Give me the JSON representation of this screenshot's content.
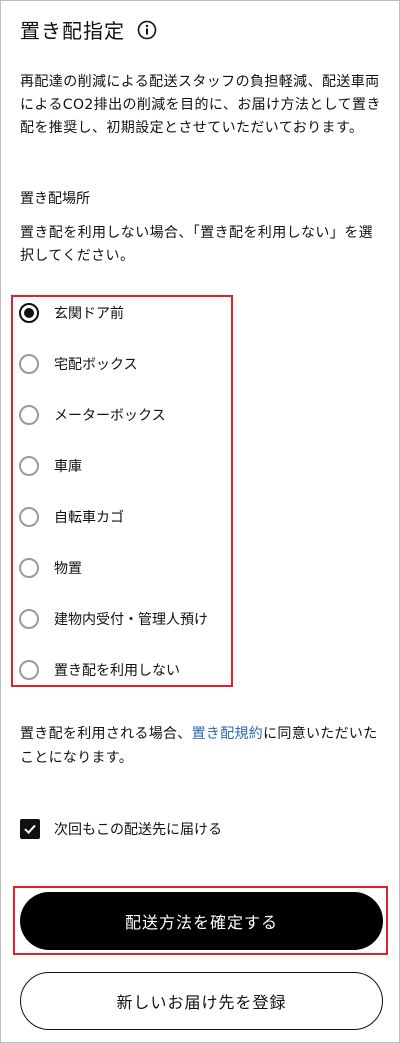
{
  "header": {
    "title": "置き配指定",
    "info_icon": "info-circle-icon"
  },
  "description": "再配達の削減による配送スタッフの負担軽減、配送車両によるCO2排出の削減を目的に、お届け方法として置き配を推奨し、初期設定とさせていただいております。",
  "placement": {
    "section_label": "置き配場所",
    "hint": "置き配を利用しない場合、「置き配を利用しない」を選択してください。",
    "options": [
      {
        "label": "玄関ドア前",
        "selected": true
      },
      {
        "label": "宅配ボックス",
        "selected": false
      },
      {
        "label": "メーターボックス",
        "selected": false
      },
      {
        "label": "車庫",
        "selected": false
      },
      {
        "label": "自転車カゴ",
        "selected": false
      },
      {
        "label": "物置",
        "selected": false
      },
      {
        "label": "建物内受付・管理人預け",
        "selected": false
      },
      {
        "label": "置き配を利用しない",
        "selected": false
      }
    ]
  },
  "consent": {
    "prefix": "置き配を利用される場合、",
    "link_text": "置き配規約",
    "suffix": "に同意いただいたことになります。"
  },
  "remember": {
    "label": "次回もこの配送先に届ける",
    "checked": true
  },
  "actions": {
    "confirm_label": "配送方法を確定する",
    "new_address_label": "新しいお届け先を登録"
  },
  "colors": {
    "link": "#2f68b3",
    "highlight_border": "#e0202a",
    "primary_button_bg": "#000000"
  }
}
